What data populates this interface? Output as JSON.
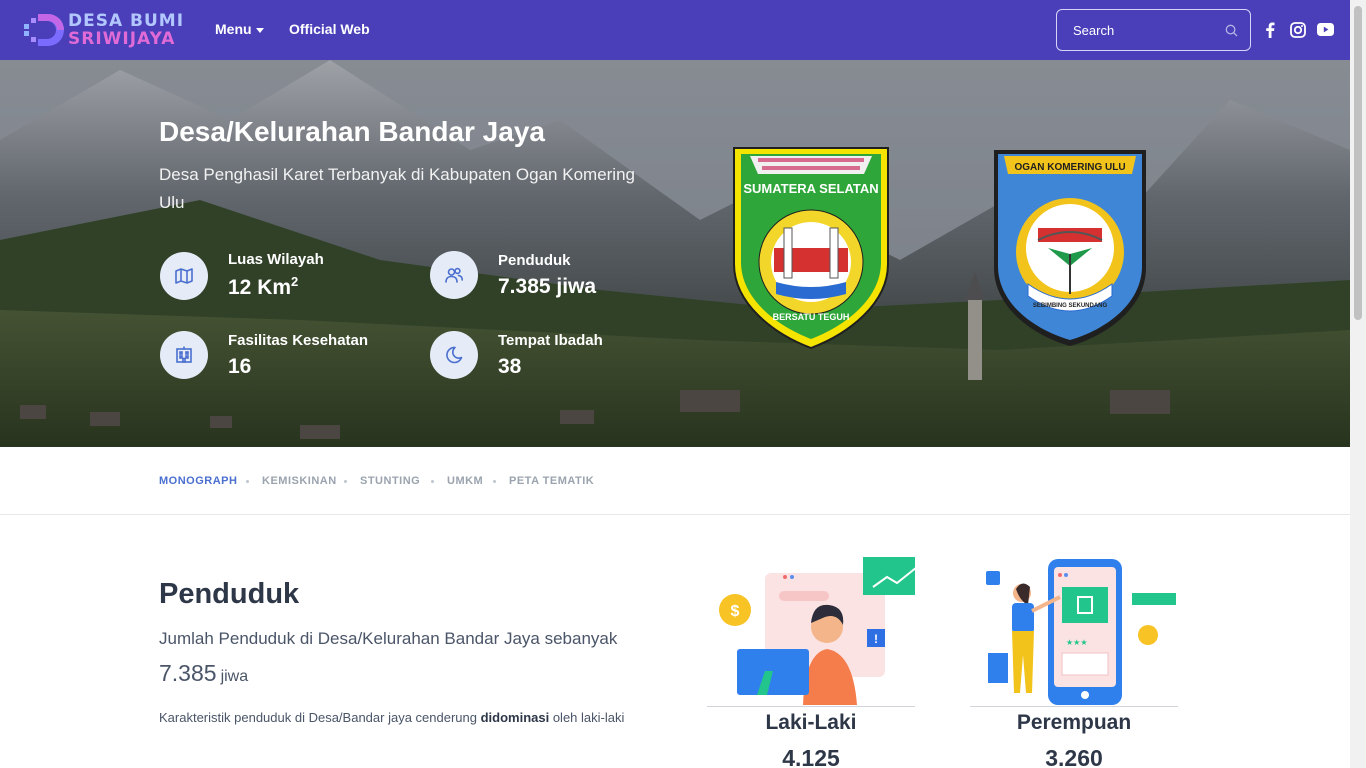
{
  "brand": {
    "line1": "DESA BUMI",
    "line2": "SRIWIJAYA"
  },
  "nav": {
    "menu_label": "Menu",
    "official_label": "Official Web",
    "search_placeholder": "Search"
  },
  "colors": {
    "navbar": "#4a3fb8",
    "accent": "#4a6fcf",
    "tab_active": "#4a6fcf"
  },
  "hero": {
    "title": "Desa/Kelurahan Bandar Jaya",
    "subtitle": "Desa Penghasil Karet Terbanyak di Kabupaten Ogan Komering Ulu",
    "stats": [
      {
        "label": "Luas Wilayah",
        "value": "12 Km",
        "sup": "2",
        "icon": "map-icon"
      },
      {
        "label": "Penduduk",
        "value": "7.385 jiwa",
        "icon": "users-icon"
      },
      {
        "label": "Fasilitas Kesehatan",
        "value": "16",
        "icon": "building-icon"
      },
      {
        "label": "Tempat Ibadah",
        "value": "38",
        "icon": "moon-icon"
      }
    ],
    "emblem_left": {
      "top": "SUMATERA SELATAN",
      "bottom": "BERSATU TEGUH"
    },
    "emblem_right": {
      "top": "OGAN KOMERING ULU",
      "bottom": "SEBIMBING SEKUNDANG"
    }
  },
  "tabs": [
    "MONOGRAPH",
    "KEMISKINAN",
    "STUNTING",
    "UMKM",
    "PETA TEMATIK"
  ],
  "section": {
    "title": "Penduduk",
    "description": "Jumlah Penduduk di Desa/Kelurahan Bandar Jaya sebanyak",
    "count": "7.385",
    "unit": "jiwa",
    "note_prefix": "Karakteristik penduduk di Desa/Bandar jaya cenderung ",
    "note_bold": "didominasi",
    "note_suffix": " oleh laki-laki"
  },
  "cards": [
    {
      "label": "Laki-Laki",
      "count": "4.125"
    },
    {
      "label": "Perempuan",
      "count": "3.260"
    }
  ]
}
